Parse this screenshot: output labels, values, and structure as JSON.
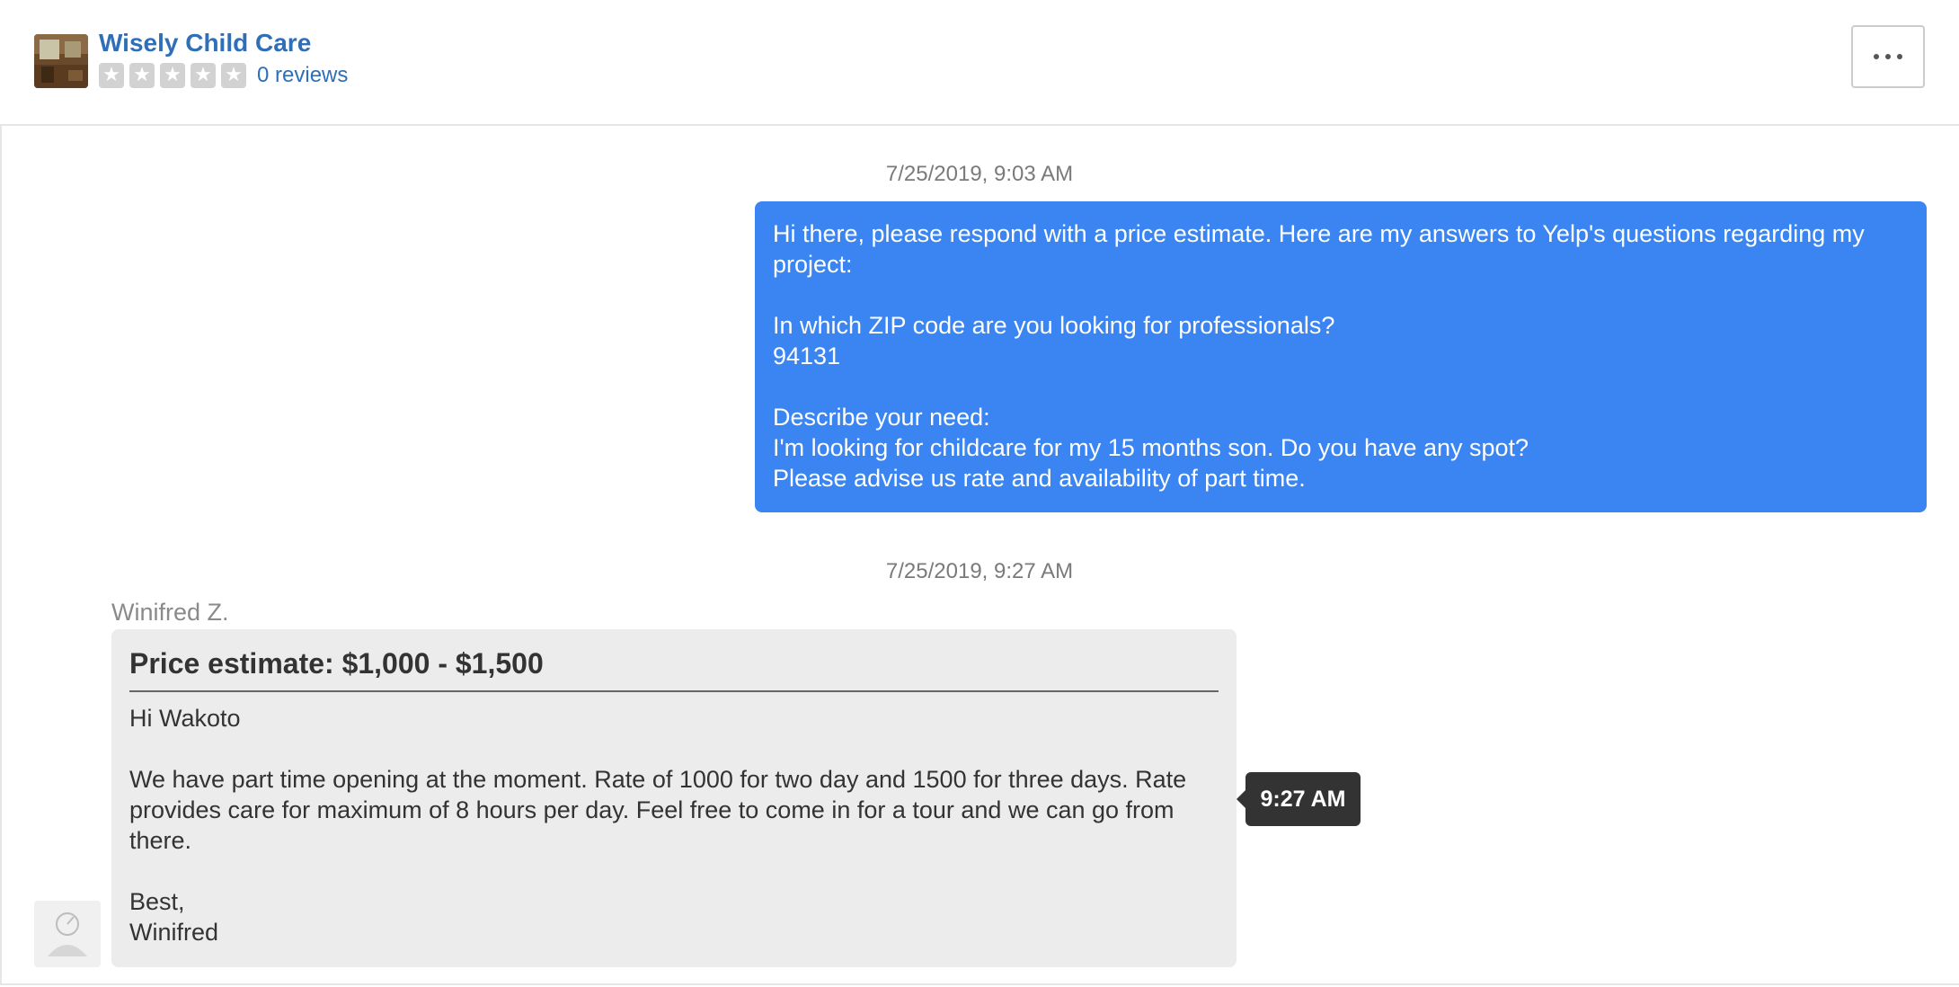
{
  "header": {
    "business_name": "Wisely Child Care",
    "rating_stars": 0,
    "reviews_label": "0 reviews",
    "more_icon": "ellipsis-icon"
  },
  "thread": {
    "messages": [
      {
        "timestamp": "7/25/2019, 9:03 AM",
        "direction": "outgoing",
        "text": "Hi there, please respond with a price estimate. Here are my answers to Yelp's questions regarding my project:\n\nIn which ZIP code are you looking for professionals?\n94131\n\nDescribe your need:\nI'm looking for childcare for my 15 months son. Do you have any spot?\nPlease advise us rate and availability of part time."
      },
      {
        "timestamp": "7/25/2019, 9:27 AM",
        "direction": "incoming",
        "sender": "Winifred Z.",
        "estimate": "Price estimate: $1,000 - $1,500",
        "text": "Hi Wakoto\n\nWe have part time opening at the moment. Rate of 1000 for two day and 1500 for three days. Rate provides care for maximum of 8 hours per day. Feel free to come in for a tour and we can go from there.\n\nBest,\nWinifred",
        "tooltip_time": "9:27 AM"
      }
    ]
  },
  "colors": {
    "link": "#2e6fb8",
    "outgoing_bubble": "#3a85f2",
    "incoming_bubble": "#ececec",
    "tooltip": "#333333"
  }
}
